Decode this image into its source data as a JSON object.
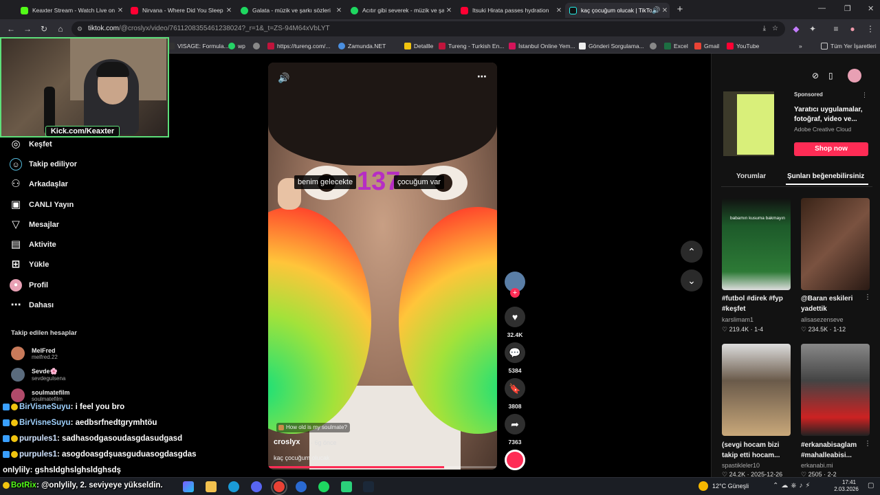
{
  "browser": {
    "tabs": [
      {
        "title": "Keaxter Stream - Watch Live on",
        "color": "#53fc18"
      },
      {
        "title": "Nirvana - Where Did You Sleep",
        "color": "#ff0033"
      },
      {
        "title": "Galata - müzik ve şarkı sözleri",
        "color": "#1ed760"
      },
      {
        "title": "Acıtır gibi severek - müzik ve şa",
        "color": "#1ed760"
      },
      {
        "title": "Itsuki Hirata passes hydration",
        "color": "#ff0033"
      },
      {
        "title": "kaç çocuğum olucak | TikTo",
        "color": "#ffffff"
      }
    ],
    "new_tab": "+",
    "url_host": "tiktok.com",
    "url_path": "/@croslyx/video/7611208355461238024?_r=1&_t=ZS-94M64xVbLYT",
    "bookmarks": [
      "VISAGE: Formula...",
      "wp",
      "https://tureng.com/...",
      "Zamunda.NET",
      "Detallle",
      "Tureng - Turkish En...",
      "İstanbul Online Yem...",
      "Gönderi Sorgulama...",
      "Excel",
      "Gmail",
      "YouTube"
    ],
    "bookmarks_folder": "Tüm Yer İşaretleri"
  },
  "webcam": {
    "label": "Kick.com/Keaxter"
  },
  "sidebar": {
    "items": [
      {
        "label": "Keşfet",
        "icon": "compass-icon"
      },
      {
        "label": "Takip ediliyor",
        "icon": "following-icon"
      },
      {
        "label": "Arkadaşlar",
        "icon": "friends-icon"
      },
      {
        "label": "CANLI Yayın",
        "icon": "live-icon"
      },
      {
        "label": "Mesajlar",
        "icon": "send-icon"
      },
      {
        "label": "Aktivite",
        "icon": "activity-icon"
      },
      {
        "label": "Yükle",
        "icon": "upload-icon"
      },
      {
        "label": "Profil",
        "icon": "profile-icon"
      },
      {
        "label": "Dahası",
        "icon": "more-icon"
      }
    ],
    "following_title": "Takip edilen hesaplar",
    "accounts": [
      {
        "name": "MelFred",
        "handle": "melfred.22"
      },
      {
        "name": "Sevde🌸",
        "handle": "sevdegulsena"
      },
      {
        "name": "soulmatefilm",
        "handle": "soulmatefilm"
      }
    ]
  },
  "chat": [
    {
      "user": "BirVisneSuyu",
      "message": ": i feel you bro",
      "color": "#9fd2ff"
    },
    {
      "user": "BirVisneSuyu",
      "message": ": aedbsrfnedtgrymhtöu",
      "color": "#9fd2ff"
    },
    {
      "user": "purpules1",
      "message": ": sadhasodgasoudasgdasudgasd",
      "color": "#cfe3ff"
    },
    {
      "user": "purpules1",
      "message": ": asogdoasgdşuasguduasogdasgdas",
      "color": "#cfe3ff"
    },
    {
      "user": "onlylily",
      "message": ": gshsldghslghsldghsdş",
      "color": "#ffffff"
    },
    {
      "user": "BotRix",
      "message": ": @onlylily, 2. seviyeye yükseldin.",
      "color": "#53fc18"
    }
  ],
  "video": {
    "caption_left": "benim gelecekte",
    "caption_right": "çocuğum var",
    "counter": "137",
    "soulmate_tag": "How old is my soulmate?",
    "author": "croslyx",
    "posted": "· 6g önce",
    "description": "kaç çocuğum olucak",
    "progress": 0.77
  },
  "actions": {
    "likes": "32.4K",
    "comments": "5384",
    "saves": "3808",
    "shares": "7363"
  },
  "ad": {
    "sponsored": "Sponsored",
    "text": "Yaratıcı uygulamalar, fotoğraf, video ve...",
    "brand": "Adobe Creative Cloud",
    "cta": "Shop now"
  },
  "right_tabs": {
    "comments": "Yorumlar",
    "suggested": "Şunları beğenebilirsiniz"
  },
  "videos": [
    {
      "title": "#futbol #direk #fyp #keşfet",
      "user": "karslimam1",
      "stats": "♡ 219.4K · 1-4",
      "thumb_text": "babamın kusuma bakmayın"
    },
    {
      "title": "@Baran eskileri yadettik",
      "user": "alisasezenseve",
      "stats": "♡ 234.5K · 1-12",
      "thumb_text": ""
    },
    {
      "title": "(sevgi hocam bizi takip etti hocam...",
      "user": "spastikleler10",
      "stats": "♡ 24.2K · 2025-12-26",
      "thumb_text": ""
    },
    {
      "title": "#erkanabisaglam #mahalleabisi...",
      "user": "erkanabi.mi",
      "stats": "♡ 2505 · 2-2",
      "thumb_text": ""
    }
  ],
  "taskbar": {
    "weather": "12°C  Güneşli",
    "time": "17:41",
    "date": "2.03.2026"
  }
}
